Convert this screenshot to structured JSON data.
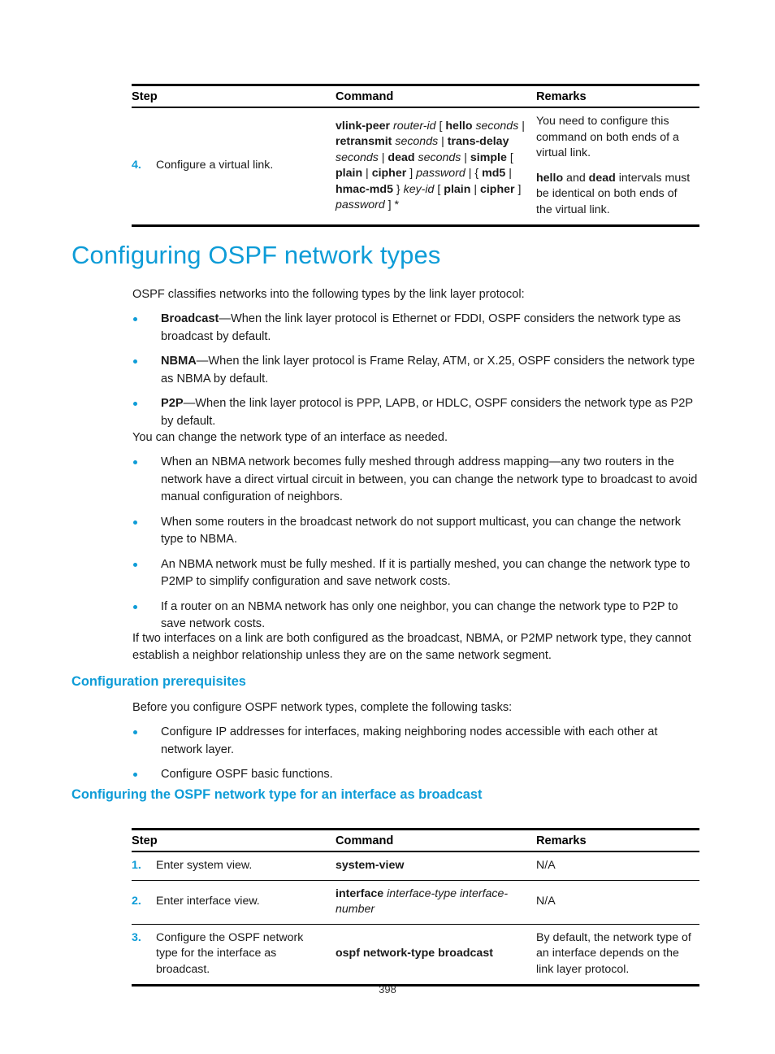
{
  "page": {
    "number": "398"
  },
  "table_virtual_link": {
    "headers": [
      "Step",
      "Command",
      "Remarks"
    ],
    "rows": [
      {
        "num": "4.",
        "step": "Configure a virtual link.",
        "command_runs": [
          {
            "t": "vlink-peer",
            "s": "bold"
          },
          {
            "t": " ",
            "s": "plain"
          },
          {
            "t": "router-id",
            "s": "italic"
          },
          {
            "t": " [ ",
            "s": "plain"
          },
          {
            "t": "hello",
            "s": "bold"
          },
          {
            "t": " ",
            "s": "plain"
          },
          {
            "t": "seconds",
            "s": "italic"
          },
          {
            "t": " | ",
            "s": "plain"
          },
          {
            "t": "retransmit",
            "s": "bold"
          },
          {
            "t": " ",
            "s": "plain"
          },
          {
            "t": "seconds",
            "s": "italic"
          },
          {
            "t": " | ",
            "s": "plain"
          },
          {
            "t": "trans-delay",
            "s": "bold"
          },
          {
            "t": " ",
            "s": "plain"
          },
          {
            "t": "seconds",
            "s": "italic"
          },
          {
            "t": " | ",
            "s": "plain"
          },
          {
            "t": "dead",
            "s": "bold"
          },
          {
            "t": " ",
            "s": "plain"
          },
          {
            "t": "seconds",
            "s": "italic"
          },
          {
            "t": " | ",
            "s": "plain"
          },
          {
            "t": "simple",
            "s": "bold"
          },
          {
            "t": " [ ",
            "s": "plain"
          },
          {
            "t": "plain",
            "s": "bold"
          },
          {
            "t": " | ",
            "s": "plain"
          },
          {
            "t": "cipher",
            "s": "bold"
          },
          {
            "t": " ] ",
            "s": "plain"
          },
          {
            "t": "password",
            "s": "italic"
          },
          {
            "t": " | { ",
            "s": "plain"
          },
          {
            "t": "md5",
            "s": "bold"
          },
          {
            "t": " | ",
            "s": "plain"
          },
          {
            "t": "hmac-md5",
            "s": "bold"
          },
          {
            "t": " } ",
            "s": "plain"
          },
          {
            "t": "key-id",
            "s": "italic"
          },
          {
            "t": " [ ",
            "s": "plain"
          },
          {
            "t": "plain",
            "s": "bold"
          },
          {
            "t": " | ",
            "s": "plain"
          },
          {
            "t": "cipher",
            "s": "bold"
          },
          {
            "t": " ] ",
            "s": "plain"
          },
          {
            "t": "password",
            "s": "italic"
          },
          {
            "t": " ] *",
            "s": "plain"
          }
        ],
        "remarks_paragraphs": [
          [
            {
              "t": "You need to configure this command on both ends of a virtual link.",
              "s": "plain"
            }
          ],
          [
            {
              "t": "hello",
              "s": "bold"
            },
            {
              "t": " and ",
              "s": "plain"
            },
            {
              "t": "dead",
              "s": "bold"
            },
            {
              "t": " intervals must be identical on both ends of the virtual link.",
              "s": "plain"
            }
          ]
        ]
      }
    ]
  },
  "section": {
    "title": "Configuring OSPF network types",
    "lead1": "OSPF classifies networks into the following types by the link layer protocol:",
    "type_bullets": [
      [
        {
          "t": "Broadcast",
          "s": "bold"
        },
        {
          "t": "—When the link layer protocol is Ethernet or FDDI, OSPF considers the network type as broadcast by default.",
          "s": "plain"
        }
      ],
      [
        {
          "t": "NBMA",
          "s": "bold"
        },
        {
          "t": "—When the link layer protocol is Frame Relay, ATM, or X.25, OSPF considers the network type as NBMA by default.",
          "s": "plain"
        }
      ],
      [
        {
          "t": "P2P",
          "s": "bold"
        },
        {
          "t": "—When the link layer protocol is PPP, LAPB, or HDLC, OSPF considers the network type as P2P by default.",
          "s": "plain"
        }
      ]
    ],
    "lead2": "You can change the network type of an interface as needed.",
    "change_bullets": [
      [
        {
          "t": "When an NBMA network becomes fully meshed through address mapping—any two routers in the network have a direct virtual circuit in between, you can change the network type to broadcast to avoid manual configuration of neighbors.",
          "s": "plain"
        }
      ],
      [
        {
          "t": "When some routers in the broadcast network do not support multicast, you can change the network type to NBMA.",
          "s": "plain"
        }
      ],
      [
        {
          "t": "An NBMA network must be fully meshed. If it is partially meshed, you can change the network type to P2MP to simplify configuration and save network costs.",
          "s": "plain"
        }
      ],
      [
        {
          "t": "If a router on an NBMA network has only one neighbor, you can change the network type to P2P to save network costs.",
          "s": "plain"
        }
      ]
    ],
    "closing": "If two interfaces on a link are both configured as the broadcast, NBMA, or P2MP network type, they cannot establish a neighbor relationship unless they are on the same network segment."
  },
  "prereq": {
    "title": "Configuration prerequisites",
    "lead": "Before you configure OSPF network types, complete the following tasks:",
    "bullets": [
      [
        {
          "t": "Configure IP addresses for interfaces, making neighboring nodes accessible with each other at network layer.",
          "s": "plain"
        }
      ],
      [
        {
          "t": "Configure OSPF basic functions.",
          "s": "plain"
        }
      ]
    ]
  },
  "broadcast_section": {
    "title": "Configuring the OSPF network type for an interface as broadcast"
  },
  "table_broadcast": {
    "headers": [
      "Step",
      "Command",
      "Remarks"
    ],
    "rows": [
      {
        "num": "1.",
        "step": "Enter system view.",
        "command_runs": [
          {
            "t": "system-view",
            "s": "bold"
          }
        ],
        "remarks_paragraphs": [
          [
            {
              "t": "N/A",
              "s": "plain"
            }
          ]
        ]
      },
      {
        "num": "2.",
        "step": "Enter interface view.",
        "command_runs": [
          {
            "t": "interface",
            "s": "bold"
          },
          {
            "t": " ",
            "s": "plain"
          },
          {
            "t": "interface-type interface-number",
            "s": "italic"
          }
        ],
        "remarks_paragraphs": [
          [
            {
              "t": "N/A",
              "s": "plain"
            }
          ]
        ]
      },
      {
        "num": "3.",
        "step": "Configure the OSPF network type for the interface as broadcast.",
        "command_runs": [
          {
            "t": "ospf network-type broadcast",
            "s": "bold"
          }
        ],
        "remarks_paragraphs": [
          [
            {
              "t": "By default, the network type of an interface depends on the link layer protocol.",
              "s": "plain"
            }
          ]
        ]
      }
    ]
  },
  "colors": {
    "accent": "#0e9cd7",
    "text": "#1a1a1a",
    "rule": "#000000"
  }
}
